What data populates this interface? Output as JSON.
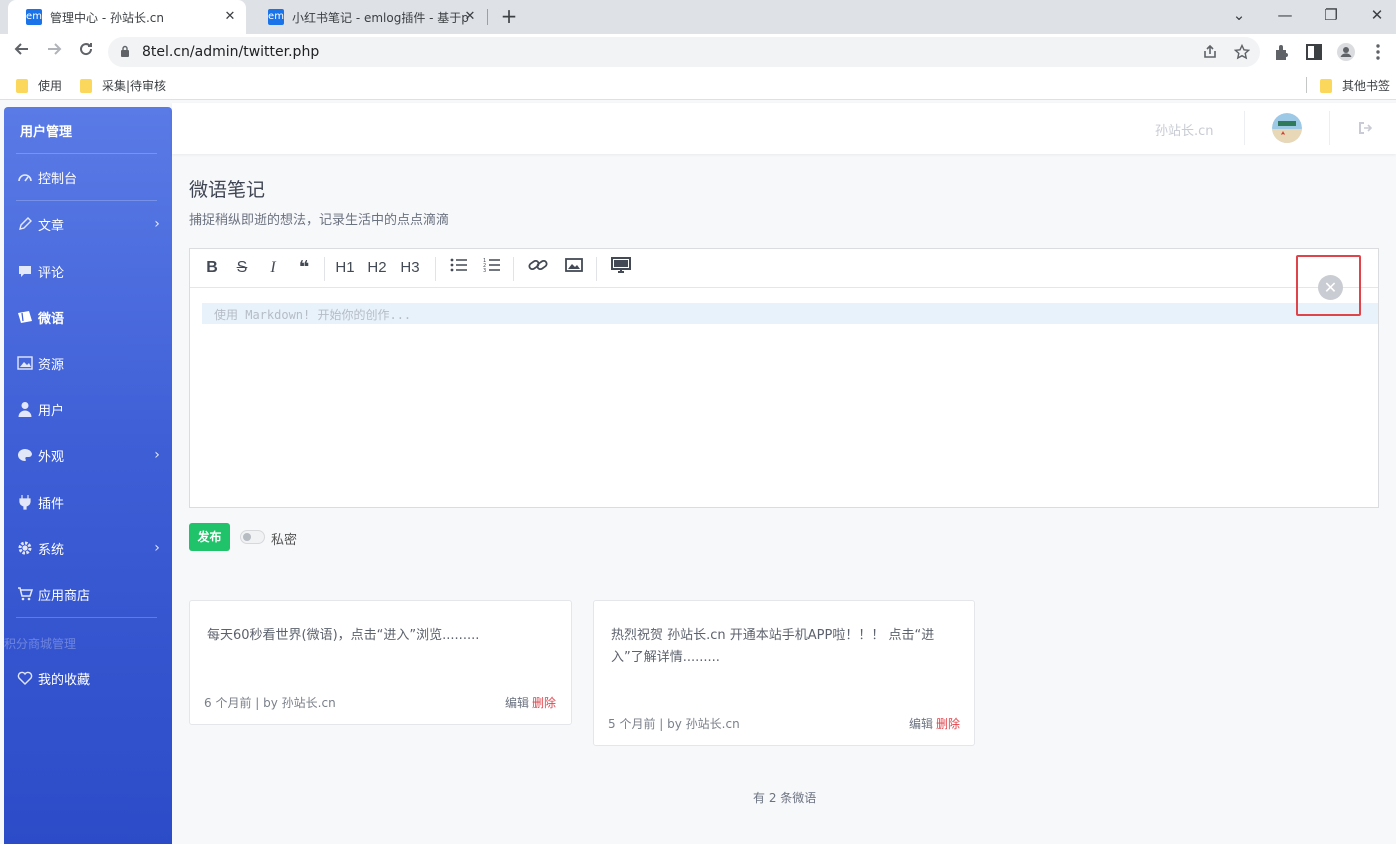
{
  "browser": {
    "tabs": [
      {
        "favicon": "em",
        "title": "管理中心 - 孙站长.cn",
        "close": "✕"
      },
      {
        "favicon": "em",
        "title": "小红书笔记 - emlog插件 - 基于p"
      }
    ],
    "new_tab": "+",
    "window_controls": {
      "minimize": "—",
      "restore": "❐",
      "close": "✕",
      "tab_search": "⌄"
    },
    "url": "8tel.cn/admin/twitter.php",
    "bookmarks": [
      "使用",
      "采集|待审核"
    ],
    "other_bookmarks": "其他书签"
  },
  "sidebar": {
    "brand": "用户管理",
    "items": [
      {
        "label": "控制台",
        "icon": "dashboard-icon",
        "chevron": ""
      },
      {
        "label": "文章",
        "icon": "pencil-icon",
        "chevron": "›"
      },
      {
        "label": "评论",
        "icon": "comment-icon",
        "chevron": ""
      },
      {
        "label": "微语",
        "icon": "ticket-icon",
        "chevron": ""
      },
      {
        "label": "资源",
        "icon": "image-icon",
        "chevron": ""
      },
      {
        "label": "用户",
        "icon": "user-icon",
        "chevron": ""
      },
      {
        "label": "外观",
        "icon": "palette-icon",
        "chevron": "›"
      },
      {
        "label": "插件",
        "icon": "plug-icon",
        "chevron": ""
      },
      {
        "label": "系统",
        "icon": "gear-icon",
        "chevron": "›"
      },
      {
        "label": "应用商店",
        "icon": "cart-icon",
        "chevron": ""
      }
    ],
    "faded_item": "积分商城管理",
    "favorites": {
      "label": "我的收藏",
      "icon": "heart-icon"
    },
    "active": "微语"
  },
  "header": {
    "site_name": "孙站长.cn"
  },
  "page": {
    "title": "微语笔记",
    "subtitle": "捕捉稍纵即逝的想法，记录生活中的点点滴滴"
  },
  "editor": {
    "toolbar": [
      "B",
      "S",
      "I",
      "❝",
      "H1",
      "H2",
      "H3",
      "list",
      "olist",
      "link",
      "image",
      "preview"
    ],
    "placeholder": "使用 Markdown! 开始你的创作...",
    "close_symbol": "✕"
  },
  "actions": {
    "publish": "发布",
    "private_label": "私密",
    "private_on": false
  },
  "posts": [
    {
      "text": "每天60秒看世界(微语)，点击“进入”浏览.........",
      "meta": "6 个月前 | by 孙站长.cn",
      "edit": "编辑",
      "delete": "删除"
    },
    {
      "text": "热烈祝贺 孙站长.cn 开通本站手机APP啦！！！ 点击“进入”了解详情.........",
      "meta": "5 个月前 | by 孙站长.cn",
      "edit": "编辑",
      "delete": "删除"
    }
  ],
  "footer": {
    "count": "有 2 条微语"
  },
  "colors": {
    "sidebar_top": "#5a7be6",
    "sidebar_bottom": "#2b4bc8",
    "publish": "#20c26a",
    "delete": "#e0444b",
    "highlight": "#e0444b"
  }
}
